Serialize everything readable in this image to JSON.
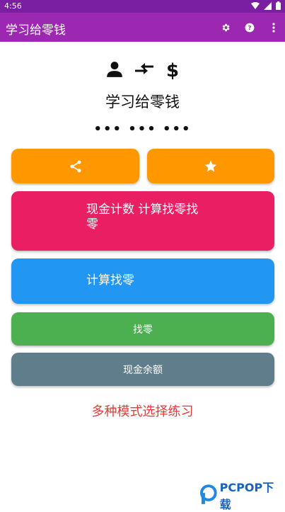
{
  "status_bar": {
    "time": "4:56"
  },
  "app_bar": {
    "title": "学习给零钱"
  },
  "hero": {
    "title": "学习给零钱",
    "dots": "••• ••• •••"
  },
  "buttons": {
    "cash_count_label": "现金计数 计算找零找零",
    "calc_change_label": "计算找零",
    "change_label": "找零",
    "balance_label": "现金余额"
  },
  "caption": "多种模式选择练习",
  "watermark": {
    "text": "PCPOP下载"
  },
  "colors": {
    "status_bar": "#7b1fa2",
    "app_bar": "#9c27b0",
    "orange": "#ff9800",
    "pink": "#e91e63",
    "blue": "#2196f3",
    "green": "#4caf50",
    "slate": "#607d8b",
    "caption_red": "#e53935"
  },
  "icons": [
    "wifi-icon",
    "signal-icon",
    "battery-icon",
    "gear-icon",
    "help-icon",
    "more-vert-icon",
    "person-icon",
    "exchange-icon",
    "dollar-icon",
    "share-icon",
    "star-icon"
  ]
}
